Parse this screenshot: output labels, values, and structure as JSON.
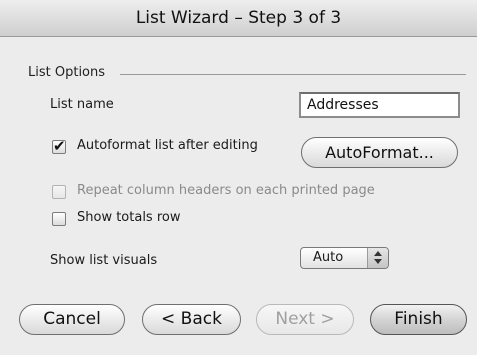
{
  "window": {
    "title": "List Wizard – Step 3 of 3"
  },
  "group": {
    "label": "List Options"
  },
  "list_name": {
    "label": "List name",
    "value": "Addresses"
  },
  "autoformat": {
    "label": "Autoformat list after editing",
    "checked": true,
    "button_label": "AutoFormat..."
  },
  "repeat_headers": {
    "label": "Repeat column headers on each printed page",
    "checked": false,
    "enabled": false
  },
  "totals_row": {
    "label": "Show totals row",
    "checked": false
  },
  "visuals": {
    "label": "Show list visuals",
    "selected": "Auto"
  },
  "buttons": {
    "cancel": "Cancel",
    "back": "< Back",
    "next": "Next >",
    "finish": "Finish"
  }
}
